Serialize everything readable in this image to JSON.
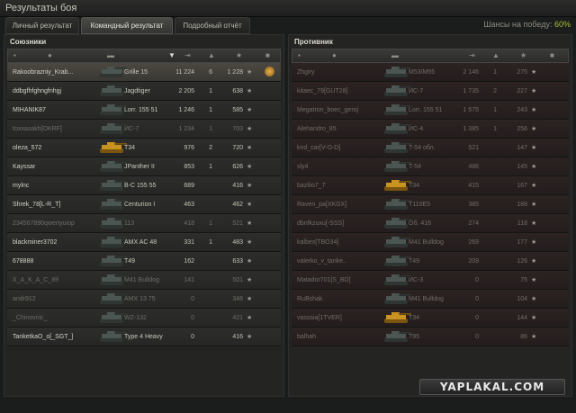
{
  "window": {
    "title": "Результаты боя"
  },
  "tabs": [
    {
      "label": "Личный результат",
      "active": false
    },
    {
      "label": "Командный результат",
      "active": true
    },
    {
      "label": "Подробный отчёт",
      "active": false
    }
  ],
  "chances": {
    "label": "Шансы на победу:",
    "value": "60%"
  },
  "icons": {
    "columns": [
      "tank-icon",
      "player-icon",
      "vehicle-icon",
      "damage-icon",
      "kills-icon",
      "xp-icon",
      "medal-icon"
    ],
    "selected": "vehicle-icon",
    "sort_indicator": "▼"
  },
  "allies": {
    "title": "Союзники",
    "rows": [
      {
        "player": "Rakoobrazniy_Krab...",
        "vehicle": "Grille 15",
        "damage": "11 224",
        "kills": "6",
        "xp": "1 228",
        "star": "★",
        "me": true,
        "dead": false,
        "medal": true
      },
      {
        "player": "ddbgfhfghngfnhgj",
        "vehicle": "Jagdtiger",
        "damage": "2 205",
        "kills": "1",
        "xp": "638",
        "star": "★",
        "dead": false
      },
      {
        "player": "MIHANIK87",
        "vehicle": "Lorr. 155 51",
        "damage": "1 246",
        "kills": "1",
        "xp": "585",
        "star": "★",
        "dead": false
      },
      {
        "player": "toxxasakh[OKRF]",
        "vehicle": "ИС-7",
        "damage": "1 234",
        "kills": "1",
        "xp": "703",
        "star": "★",
        "dead": true
      },
      {
        "player": "oleza_572",
        "vehicle": "T34",
        "damage": "976",
        "kills": "2",
        "xp": "720",
        "star": "★",
        "dead": false,
        "gold": true
      },
      {
        "player": "Kayssar",
        "vehicle": "JPanther II",
        "damage": "853",
        "kills": "1",
        "xp": "626",
        "star": "★",
        "dead": false
      },
      {
        "player": "mylnc",
        "vehicle": "B-C 155 55",
        "damage": "689",
        "kills": "",
        "xp": "416",
        "star": "★",
        "dead": false
      },
      {
        "player": "Shrek_78[L-R_T]",
        "vehicle": "Centurion I",
        "damage": "463",
        "kills": "",
        "xp": "462",
        "star": "★",
        "dead": false
      },
      {
        "player": "234567890qwertyuiop",
        "vehicle": "113",
        "damage": "418",
        "kills": "1",
        "xp": "521",
        "star": "★",
        "dead": true
      },
      {
        "player": "blackminer3702",
        "vehicle": "AMX AC 48",
        "damage": "331",
        "kills": "1",
        "xp": "483",
        "star": "★",
        "dead": false
      },
      {
        "player": "678888",
        "vehicle": "T49",
        "damage": "162",
        "kills": "",
        "xp": "633",
        "star": "★",
        "dead": false
      },
      {
        "player": "X_A_K_A_C_89",
        "vehicle": "M41 Bulldog",
        "damage": "141",
        "kills": "",
        "xp": "501",
        "star": "★",
        "dead": true
      },
      {
        "player": "andr912",
        "vehicle": "AMX 13 75",
        "damage": "0",
        "kills": "",
        "xp": "348",
        "star": "★",
        "dead": true
      },
      {
        "player": "_Chinovnic_",
        "vehicle": "WZ-132",
        "damage": "0",
        "kills": "",
        "xp": "421",
        "star": "★",
        "dead": true
      },
      {
        "player": "TanketkaO_o[_SGT_]",
        "vehicle": "Type 4 Heavy",
        "damage": "0",
        "kills": "",
        "xp": "416",
        "star": "★",
        "dead": false
      }
    ]
  },
  "enemies": {
    "title": "Противник",
    "rows": [
      {
        "player": "Zhgiry",
        "vehicle": "M53/M55",
        "damage": "2 146",
        "kills": "1",
        "xp": "275",
        "star": "★",
        "dead": true
      },
      {
        "player": "kitaec_79[GUT28]",
        "vehicle": "ИС-7",
        "damage": "1 735",
        "kills": "2",
        "xp": "227",
        "star": "★",
        "dead": true
      },
      {
        "player": "Megatron_boec_geroj",
        "vehicle": "Lorr. 155 51",
        "damage": "1 675",
        "kills": "1",
        "xp": "243",
        "star": "★",
        "dead": true
      },
      {
        "player": "Alehandro_85",
        "vehicle": "ИС-4",
        "damage": "1 385",
        "kills": "1",
        "xp": "256",
        "star": "★",
        "dead": true
      },
      {
        "player": "knd_car[V-O-D]",
        "vehicle": "T-54 обл.",
        "damage": "521",
        "kills": "",
        "xp": "147",
        "star": "★",
        "dead": true
      },
      {
        "player": "sly4",
        "vehicle": "T-54",
        "damage": "486",
        "kills": "",
        "xp": "145",
        "star": "★",
        "dead": true
      },
      {
        "player": "bazilio7_7",
        "vehicle": "T34",
        "damage": "415",
        "kills": "",
        "xp": "167",
        "star": "★",
        "dead": true,
        "gold": true
      },
      {
        "player": "Raven_pa[XKGX]",
        "vehicle": "T110E5",
        "damage": "385",
        "kills": "",
        "xp": "188",
        "star": "★",
        "dead": true
      },
      {
        "player": "dbnfkzuxu[-SSS]",
        "vehicle": "Об. 416",
        "damage": "274",
        "kills": "",
        "xp": "118",
        "star": "★",
        "dead": true
      },
      {
        "player": "kalbex[TBO34]",
        "vehicle": "M41 Bulldog",
        "damage": "269",
        "kills": "",
        "xp": "177",
        "star": "★",
        "dead": true
      },
      {
        "player": "valerko_v_tanke..",
        "vehicle": "T49",
        "damage": "209",
        "kills": "",
        "xp": "126",
        "star": "★",
        "dead": true
      },
      {
        "player": "Matador701[S_BD]",
        "vehicle": "ИС-3",
        "damage": "0",
        "kills": "",
        "xp": "75",
        "star": "★",
        "dead": true
      },
      {
        "player": "RuBshak",
        "vehicle": "M41 Bulldog",
        "damage": "0",
        "kills": "",
        "xp": "104",
        "star": "★",
        "dead": true
      },
      {
        "player": "vasssia[1TVER]",
        "vehicle": "T34",
        "damage": "0",
        "kills": "",
        "xp": "144",
        "star": "★",
        "dead": true,
        "gold": true
      },
      {
        "player": "balhah",
        "vehicle": "T95",
        "damage": "0",
        "kills": "",
        "xp": "86",
        "star": "★",
        "dead": true
      }
    ]
  },
  "watermark": {
    "text": "YAPLAKAL.COM"
  },
  "colors": {
    "accent_green": "#a9c03a",
    "ally_row": "#2d2e2c",
    "enemy_row": "#2c2322",
    "gold_tank": "#c9931f"
  }
}
